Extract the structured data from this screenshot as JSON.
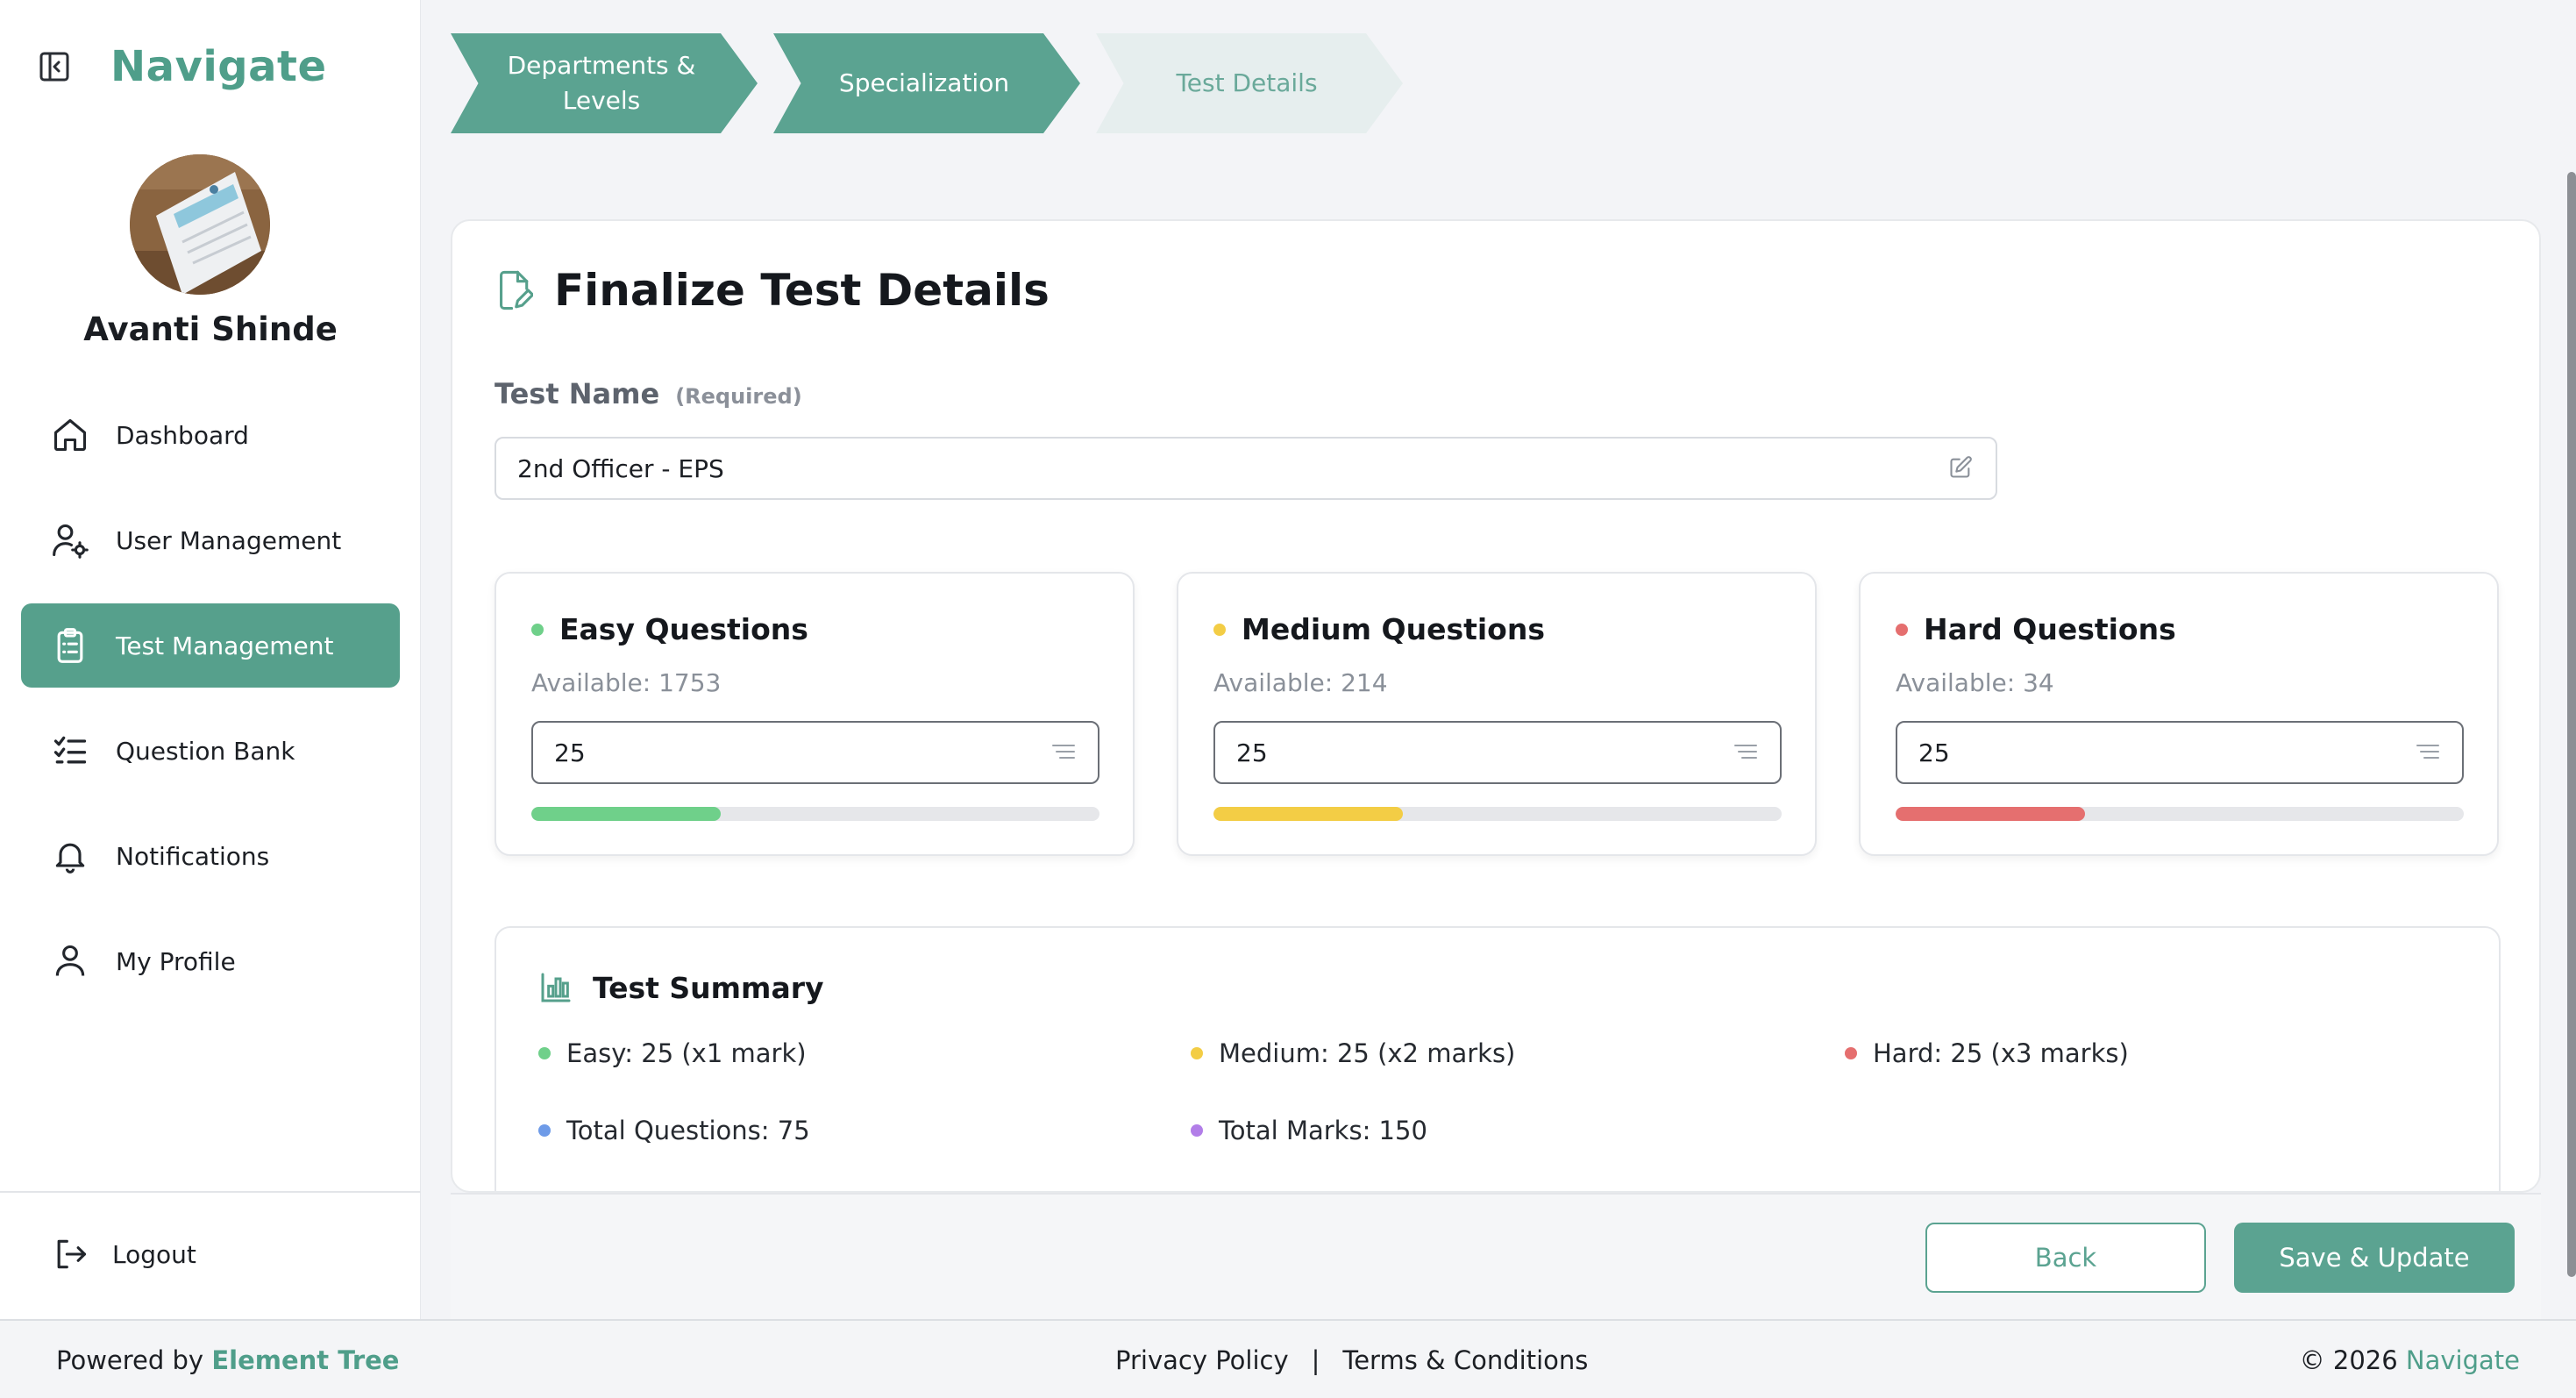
{
  "brand": {
    "name": "Navigate"
  },
  "user": {
    "name": "Avanti Shinde"
  },
  "nav": [
    {
      "label": "Dashboard",
      "icon": "home-icon"
    },
    {
      "label": "User Management",
      "icon": "user-gear-icon"
    },
    {
      "label": "Test Management",
      "icon": "clipboard-icon",
      "active": true
    },
    {
      "label": "Question Bank",
      "icon": "checklist-icon"
    },
    {
      "label": "Notifications",
      "icon": "bell-icon"
    },
    {
      "label": "My Profile",
      "icon": "person-icon"
    }
  ],
  "logout": {
    "label": "Logout"
  },
  "steps": [
    {
      "label": "Departments & Levels",
      "state": "done"
    },
    {
      "label": "Specialization",
      "state": "done"
    },
    {
      "label": "Test Details",
      "state": "current"
    }
  ],
  "form": {
    "title": "Finalize Test Details",
    "test_name_label": "Test Name",
    "required": "(Required)",
    "test_name_value": "2nd Officer - EPS"
  },
  "questions": [
    {
      "title": "Easy Questions",
      "available": "Available: 1753",
      "value": "25",
      "color": "#6fd08a",
      "fill_fraction": 0.333
    },
    {
      "title": "Medium Questions",
      "available": "Available: 214",
      "value": "25",
      "color": "#f3cd45",
      "fill_fraction": 0.333
    },
    {
      "title": "Hard Questions",
      "available": "Available: 34",
      "value": "25",
      "color": "#e56f6f",
      "fill_fraction": 0.333
    }
  ],
  "summary": {
    "title": "Test Summary",
    "easy": "Easy: 25 (x1 mark)",
    "medium": "Medium: 25 (x2 marks)",
    "hard": "Hard: 25 (x3 marks)",
    "total_questions": "Total Questions: 75",
    "total_marks": "Total Marks: 150",
    "colors": {
      "easy": "#6fd08a",
      "medium": "#f3cd45",
      "hard": "#e56f6f",
      "total_questions": "#6e9be8",
      "total_marks": "#b27ee8"
    }
  },
  "actions": {
    "back": "Back",
    "save": "Save & Update"
  },
  "footer": {
    "powered_by": "Powered by",
    "company": "Element Tree",
    "privacy": "Privacy Policy",
    "separator": "|",
    "terms": "Terms & Conditions",
    "copyright": "© 2026",
    "brand": "Navigate"
  },
  "accent_color": "#56a08c"
}
